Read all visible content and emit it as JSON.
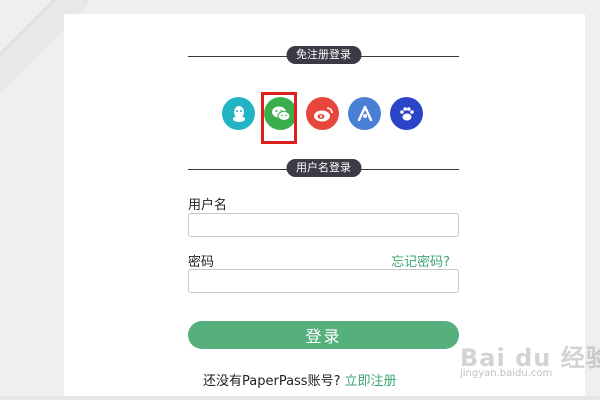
{
  "quick_login": {
    "heading": "免注册登录",
    "providers": [
      {
        "name": "qq-icon",
        "color": "#22b3c4"
      },
      {
        "name": "wechat-icon",
        "color": "#3aae4b"
      },
      {
        "name": "weibo-icon",
        "color": "#e8453c"
      },
      {
        "name": "baidu-paw-alt-icon",
        "color": "#4a7fd6"
      },
      {
        "name": "baidu-paw-icon",
        "color": "#2a45c8"
      }
    ],
    "highlight_color": "#e0201c"
  },
  "account_login": {
    "heading": "用户名登录",
    "username_label": "用户名",
    "username_value": "",
    "password_label": "密码",
    "password_value": "",
    "forgot_password": "忘记密码?",
    "login_button": "登录",
    "register_prompt": "还没有PaperPass账号?",
    "register_link": "立即注册"
  },
  "colors": {
    "accent_green": "#55b07e",
    "link_green": "#3da56f",
    "pill_dark": "#3b3b45"
  },
  "watermark": {
    "brand": "Bai du 经验",
    "url": "jingyan.baidu.com"
  }
}
